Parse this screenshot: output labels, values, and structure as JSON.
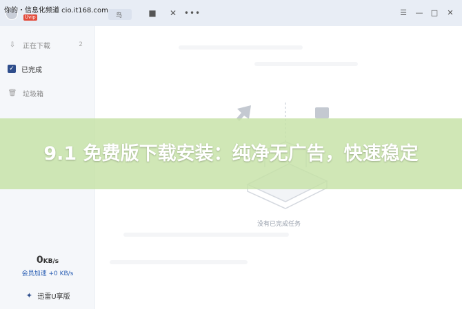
{
  "watermark": "你的・信息化频道  cio.it168.com",
  "user": {
    "vip_badge": "Uvip"
  },
  "titlebar": {
    "brand_chip": "鸟"
  },
  "sidebar": {
    "items": [
      {
        "label": "正在下载",
        "count": "2"
      },
      {
        "label": "已完成"
      },
      {
        "label": "垃圾箱"
      }
    ],
    "speed": {
      "value": "0",
      "unit": "KB/s"
    },
    "member_speed": "会员加速 +0 KB/s",
    "u_version": "迅雷U享版"
  },
  "main": {
    "empty_text": "没有已完成任务"
  },
  "banner": {
    "text": "9.1 免费版下载安装：纯净无广告，快速稳定"
  },
  "colors": {
    "titlebar_bg": "#e8edf5",
    "sidebar_bg": "#f5f7fa",
    "accent": "#2f4e8c",
    "banner_bg": "#c6e2a6"
  }
}
